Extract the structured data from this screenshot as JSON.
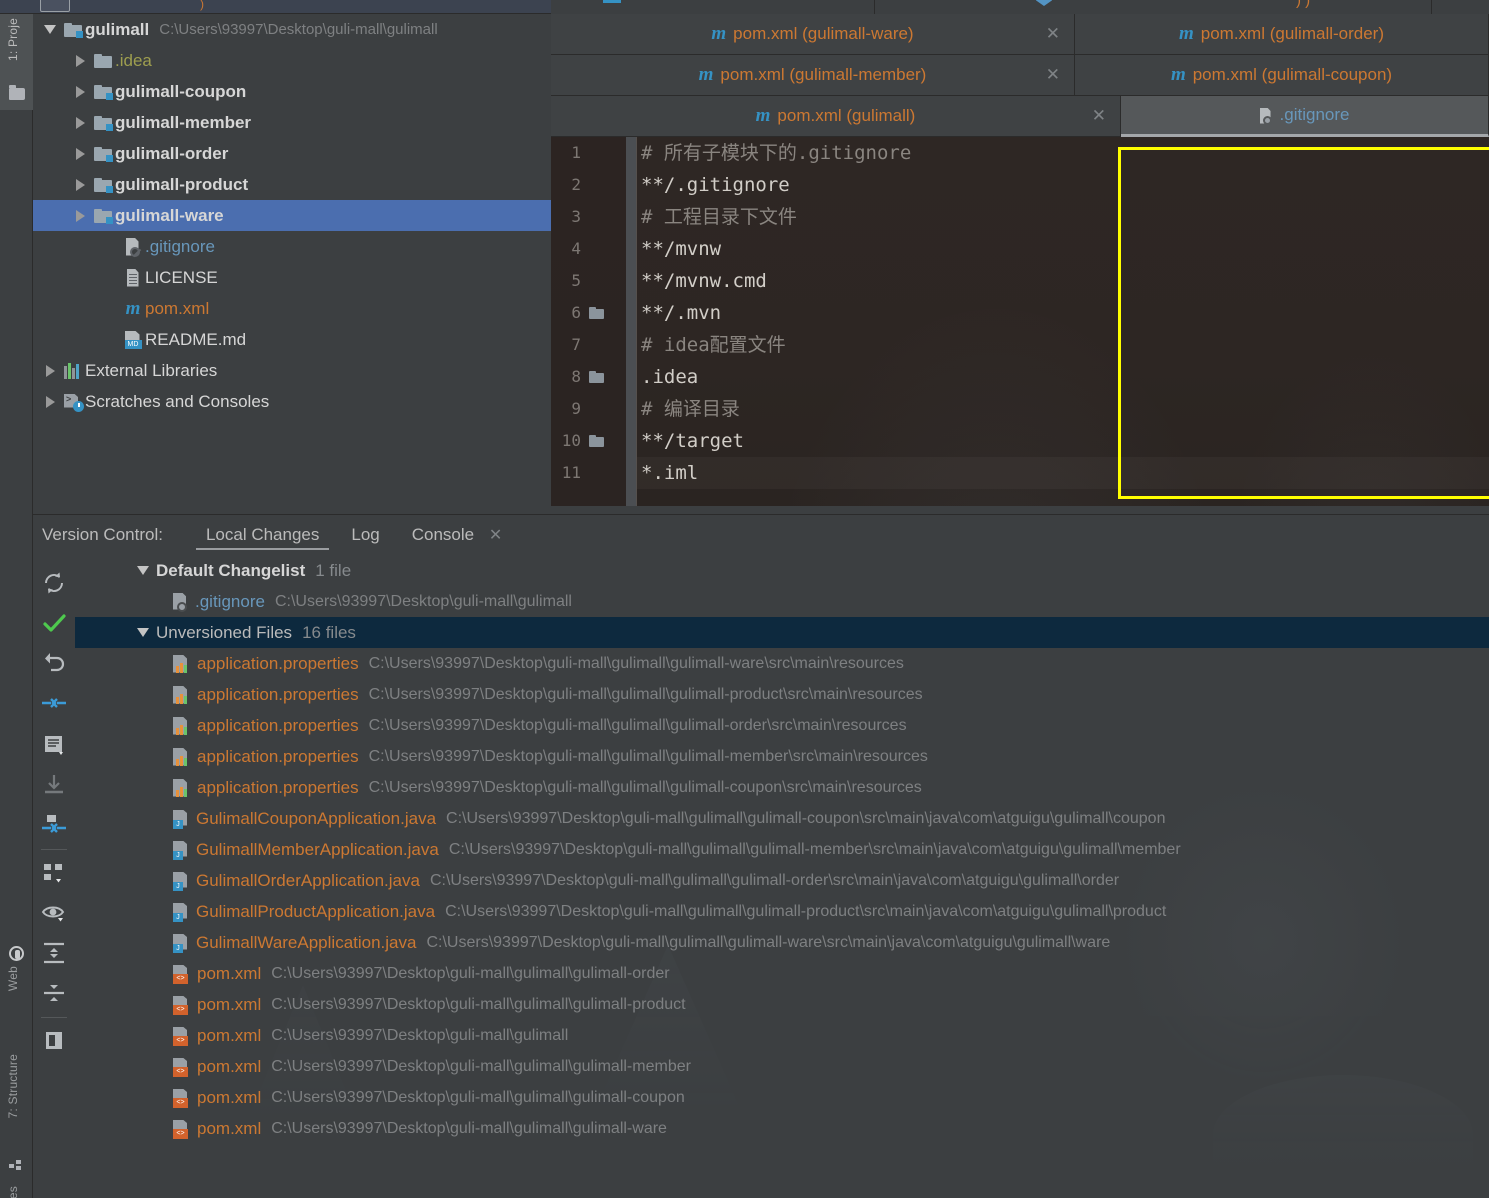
{
  "top_toolbar": {
    "partial": true
  },
  "left_strip": {
    "project_label": "1: Proje",
    "structure_label": "7: Structure",
    "web_label": "Web",
    "favorites_partial": "es"
  },
  "project_tree": {
    "items": [
      {
        "name": "gulimall",
        "path": "C:\\Users\\93997\\Desktop\\guli-mall\\gulimall",
        "icon": "module-folder-icon",
        "arrow": "down",
        "indent": 0,
        "style": "bold",
        "selected": false
      },
      {
        "name": ".idea",
        "path": "",
        "icon": "plain-folder-icon",
        "arrow": "right",
        "indent": 1,
        "style": "yellowish",
        "selected": false
      },
      {
        "name": "gulimall-coupon",
        "path": "",
        "icon": "module-folder-icon",
        "arrow": "right",
        "indent": 1,
        "style": "bold",
        "selected": false
      },
      {
        "name": "gulimall-member",
        "path": "",
        "icon": "module-folder-icon",
        "arrow": "right",
        "indent": 1,
        "style": "bold",
        "selected": false
      },
      {
        "name": "gulimall-order",
        "path": "",
        "icon": "module-folder-icon",
        "arrow": "right",
        "indent": 1,
        "style": "bold",
        "selected": false
      },
      {
        "name": "gulimall-product",
        "path": "",
        "icon": "module-folder-icon",
        "arrow": "right",
        "indent": 1,
        "style": "bold",
        "selected": false
      },
      {
        "name": "gulimall-ware",
        "path": "",
        "icon": "module-folder-icon",
        "arrow": "right",
        "indent": 1,
        "style": "bold",
        "selected": true
      },
      {
        "name": ".gitignore",
        "path": "",
        "icon": "gitignore-icon",
        "arrow": "none",
        "indent": 2,
        "style": "blueish",
        "selected": false
      },
      {
        "name": "LICENSE",
        "path": "",
        "icon": "license-icon",
        "arrow": "none",
        "indent": 2,
        "style": "plain",
        "selected": false
      },
      {
        "name": "pom.xml",
        "path": "",
        "icon": "maven-icon",
        "arrow": "none",
        "indent": 2,
        "style": "reddish",
        "selected": false
      },
      {
        "name": "README.md",
        "path": "",
        "icon": "markdown-icon",
        "arrow": "none",
        "indent": 2,
        "style": "plain",
        "selected": false
      },
      {
        "name": "External Libraries",
        "path": "",
        "icon": "external-libraries-icon",
        "arrow": "right",
        "indent": 0,
        "style": "plain",
        "selected": false
      },
      {
        "name": "Scratches and Consoles",
        "path": "",
        "icon": "scratches-icon",
        "arrow": "right",
        "indent": 0,
        "style": "plain",
        "selected": false
      }
    ]
  },
  "editor_tabs": {
    "rows": [
      [
        {
          "label": "pom.xml (gulimall-ware)",
          "icon": "maven-icon",
          "closable": true,
          "active": false
        },
        {
          "label": "pom.xml (gulimall-order)",
          "icon": "maven-icon",
          "closable": false,
          "active": false
        }
      ],
      [
        {
          "label": "pom.xml (gulimall-member)",
          "icon": "maven-icon",
          "closable": true,
          "active": false
        },
        {
          "label": "pom.xml (gulimall-coupon)",
          "icon": "maven-icon",
          "closable": false,
          "active": false
        }
      ],
      [
        {
          "label": "pom.xml (gulimall)",
          "icon": "maven-icon",
          "closable": true,
          "active": false
        },
        {
          "label": ".gitignore",
          "icon": "gitignore-icon",
          "closable": false,
          "active": true
        }
      ]
    ],
    "close_glyph": "✕"
  },
  "code_editor": {
    "filename": ".gitignore",
    "highlight_color": "#ffff00",
    "lines": [
      {
        "num": "1",
        "text": "# 所有子模块下的.gitignore",
        "type": "comment",
        "fold": false
      },
      {
        "num": "2",
        "text": "**/.gitignore",
        "type": "plain",
        "fold": false
      },
      {
        "num": "3",
        "text": "# 工程目录下文件",
        "type": "comment",
        "fold": false
      },
      {
        "num": "4",
        "text": "**/mvnw",
        "type": "plain",
        "fold": false
      },
      {
        "num": "5",
        "text": "**/mvnw.cmd",
        "type": "plain",
        "fold": false
      },
      {
        "num": "6",
        "text": "**/.mvn",
        "type": "plain",
        "fold": true
      },
      {
        "num": "7",
        "text": "# idea配置文件",
        "type": "comment",
        "fold": false
      },
      {
        "num": "8",
        "text": ".idea",
        "type": "plain",
        "fold": true
      },
      {
        "num": "9",
        "text": "# 编译目录",
        "type": "comment",
        "fold": false
      },
      {
        "num": "10",
        "text": "**/target",
        "type": "plain",
        "fold": true
      },
      {
        "num": "11",
        "text": "*.iml",
        "type": "plain",
        "fold": false,
        "caret": true
      }
    ]
  },
  "version_control": {
    "title": "Version Control:",
    "tabs": [
      {
        "label": "Local Changes",
        "active": true,
        "closable": false
      },
      {
        "label": "Log",
        "active": false,
        "closable": false
      },
      {
        "label": "Console",
        "active": false,
        "closable": true
      }
    ],
    "close_glyph": "✕",
    "toolbar_icons": [
      "refresh-icon",
      "commit-check-icon",
      "revert-icon",
      "collapse-arrows-icon",
      "show-diff-icon",
      "download-icon",
      "shelve-icon",
      "group-by-icon",
      "eye-preview-icon",
      "expand-all-icon",
      "collapse-all-icon",
      "preview-pane-icon"
    ],
    "groups": [
      {
        "name": "Default Changelist",
        "count": "1 file",
        "selected": false,
        "bold": true,
        "files": [
          {
            "name": ".gitignore",
            "path": "C:\\Users\\93997\\Desktop\\guli-mall\\gulimall",
            "icon": "gitignore-icon",
            "color": "blue"
          }
        ]
      },
      {
        "name": "Unversioned Files",
        "count": "16 files",
        "selected": true,
        "bold": false,
        "files": [
          {
            "name": "application.properties",
            "path": "C:\\Users\\93997\\Desktop\\guli-mall\\gulimall\\gulimall-ware\\src\\main\\resources",
            "icon": "properties-icon",
            "color": "orange"
          },
          {
            "name": "application.properties",
            "path": "C:\\Users\\93997\\Desktop\\guli-mall\\gulimall\\gulimall-product\\src\\main\\resources",
            "icon": "properties-icon",
            "color": "orange"
          },
          {
            "name": "application.properties",
            "path": "C:\\Users\\93997\\Desktop\\guli-mall\\gulimall\\gulimall-order\\src\\main\\resources",
            "icon": "properties-icon",
            "color": "orange"
          },
          {
            "name": "application.properties",
            "path": "C:\\Users\\93997\\Desktop\\guli-mall\\gulimall\\gulimall-member\\src\\main\\resources",
            "icon": "properties-icon",
            "color": "orange"
          },
          {
            "name": "application.properties",
            "path": "C:\\Users\\93997\\Desktop\\guli-mall\\gulimall\\gulimall-coupon\\src\\main\\resources",
            "icon": "properties-icon",
            "color": "orange"
          },
          {
            "name": "GulimallCouponApplication.java",
            "path": "C:\\Users\\93997\\Desktop\\guli-mall\\gulimall\\gulimall-coupon\\src\\main\\java\\com\\atguigu\\gulimall\\coupon",
            "icon": "java-icon",
            "color": "orange"
          },
          {
            "name": "GulimallMemberApplication.java",
            "path": "C:\\Users\\93997\\Desktop\\guli-mall\\gulimall\\gulimall-member\\src\\main\\java\\com\\atguigu\\gulimall\\member",
            "icon": "java-icon",
            "color": "orange"
          },
          {
            "name": "GulimallOrderApplication.java",
            "path": "C:\\Users\\93997\\Desktop\\guli-mall\\gulimall\\gulimall-order\\src\\main\\java\\com\\atguigu\\gulimall\\order",
            "icon": "java-icon",
            "color": "orange"
          },
          {
            "name": "GulimallProductApplication.java",
            "path": "C:\\Users\\93997\\Desktop\\guli-mall\\gulimall\\gulimall-product\\src\\main\\java\\com\\atguigu\\gulimall\\product",
            "icon": "java-icon",
            "color": "orange"
          },
          {
            "name": "GulimallWareApplication.java",
            "path": "C:\\Users\\93997\\Desktop\\guli-mall\\gulimall\\gulimall-ware\\src\\main\\java\\com\\atguigu\\gulimall\\ware",
            "icon": "java-icon",
            "color": "orange"
          },
          {
            "name": "pom.xml",
            "path": "C:\\Users\\93997\\Desktop\\guli-mall\\gulimall\\gulimall-order",
            "icon": "xml-icon",
            "color": "orange"
          },
          {
            "name": "pom.xml",
            "path": "C:\\Users\\93997\\Desktop\\guli-mall\\gulimall\\gulimall-product",
            "icon": "xml-icon",
            "color": "orange"
          },
          {
            "name": "pom.xml",
            "path": "C:\\Users\\93997\\Desktop\\guli-mall\\gulimall",
            "icon": "xml-icon",
            "color": "orange"
          },
          {
            "name": "pom.xml",
            "path": "C:\\Users\\93997\\Desktop\\guli-mall\\gulimall\\gulimall-member",
            "icon": "xml-icon",
            "color": "orange"
          },
          {
            "name": "pom.xml",
            "path": "C:\\Users\\93997\\Desktop\\guli-mall\\gulimall\\gulimall-coupon",
            "icon": "xml-icon",
            "color": "orange"
          },
          {
            "name": "pom.xml",
            "path": "C:\\Users\\93997\\Desktop\\guli-mall\\gulimall\\gulimall-ware",
            "icon": "xml-icon",
            "color": "orange"
          }
        ]
      }
    ]
  },
  "colors": {
    "panel_bg": "#3c3f41",
    "editor_bg": "#2e2724",
    "tree_selection": "#4b6eaf",
    "list_selection": "#0d293e",
    "accent_orange": "#cc7832",
    "accent_blue": "#6897bb",
    "highlight_yellow": "#ffff00"
  }
}
